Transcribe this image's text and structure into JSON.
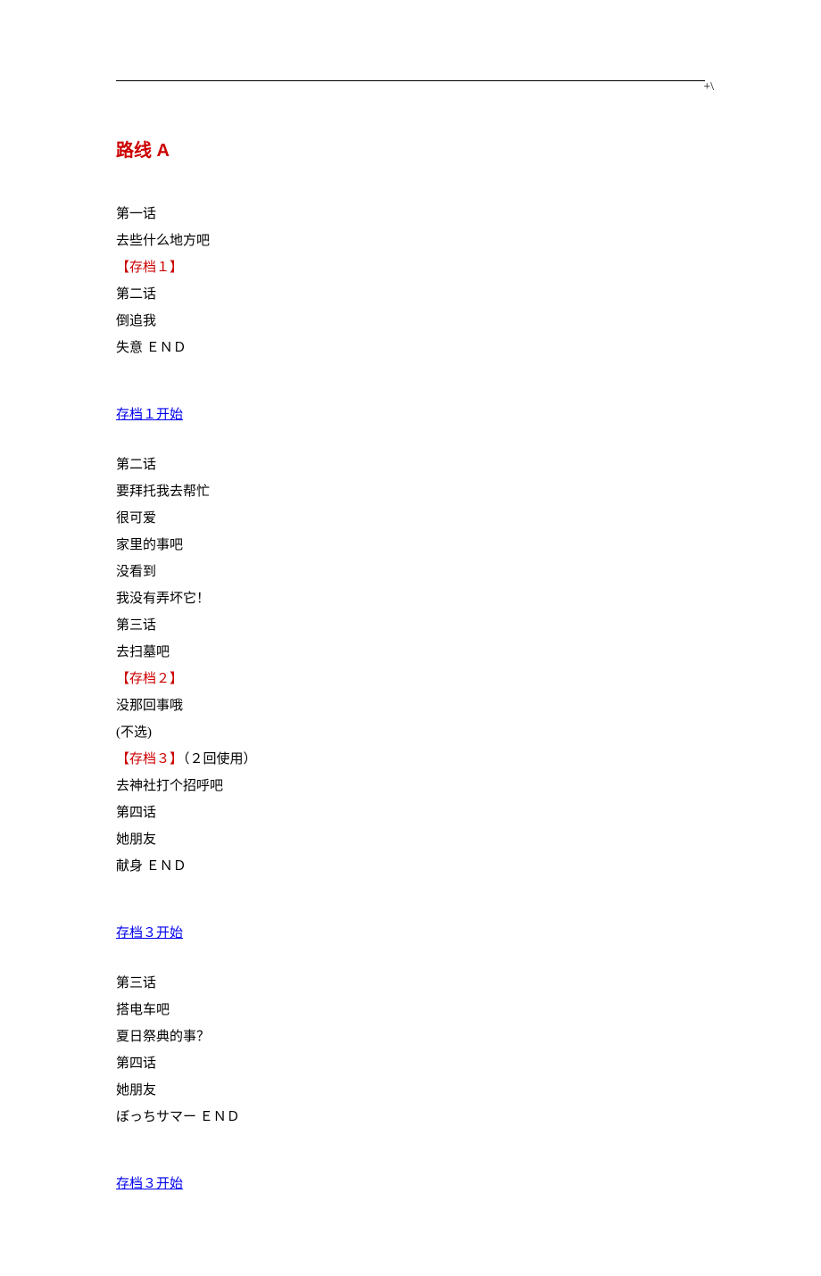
{
  "header": {
    "mark": "+\\"
  },
  "title": "路线 A",
  "sections": [
    {
      "heading": null,
      "lines": [
        {
          "text": "第一话",
          "red": false
        },
        {
          "text": "去些什么地方吧",
          "red": false
        },
        {
          "text": "【存档１】",
          "red": true
        },
        {
          "text": "第二话",
          "red": false
        },
        {
          "text": "倒追我",
          "red": false
        },
        {
          "text": "失意 ＥＮＤ",
          "red": false
        }
      ]
    },
    {
      "heading": "存档１开始",
      "lines": [
        {
          "text": "第二话",
          "red": false
        },
        {
          "text": "要拜托我去帮忙",
          "red": false
        },
        {
          "text": "很可爱",
          "red": false
        },
        {
          "text": "家里的事吧",
          "red": false
        },
        {
          "text": "没看到",
          "red": false
        },
        {
          "text": "我没有弄坏它！",
          "red": false
        },
        {
          "text": "第三话",
          "red": false
        },
        {
          "text": "去扫墓吧",
          "red": false
        },
        {
          "text": "【存档２】",
          "red": true
        },
        {
          "text": "没那回事哦",
          "red": false
        },
        {
          "text": "(不选)",
          "red": false
        },
        {
          "text": "【存档３】",
          "red": true,
          "suffix": "（２回使用）"
        },
        {
          "text": "去神社打个招呼吧",
          "red": false
        },
        {
          "text": "第四话",
          "red": false
        },
        {
          "text": "她朋友",
          "red": false
        },
        {
          "text": "献身 ＥＮＤ",
          "red": false
        }
      ]
    },
    {
      "heading": "存档３开始",
      "lines": [
        {
          "text": "第三话",
          "red": false
        },
        {
          "text": "搭电车吧",
          "red": false
        },
        {
          "text": "夏日祭典的事？",
          "red": false
        },
        {
          "text": "第四话",
          "red": false
        },
        {
          "text": "她朋友",
          "red": false
        },
        {
          "text": "ぼっちサマー ＥＮＤ",
          "red": false
        }
      ]
    },
    {
      "heading": "存档３开始",
      "lines": []
    }
  ]
}
